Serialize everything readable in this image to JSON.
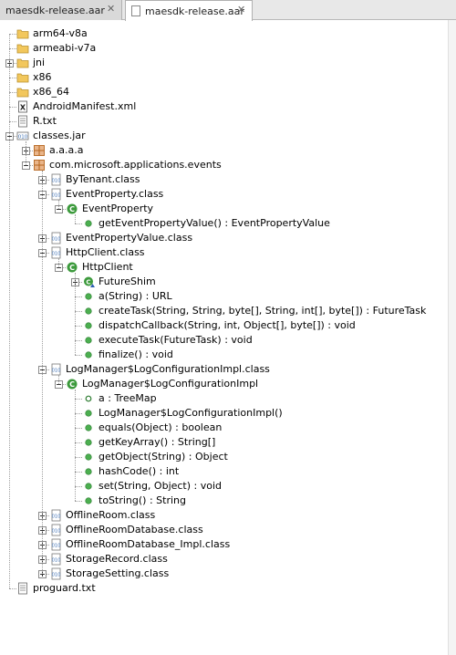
{
  "tabs": [
    {
      "label": "maesdk-release.aar",
      "active": false
    },
    {
      "label": "maesdk-release.aar",
      "active": true
    }
  ],
  "tree": [
    {
      "label": "arm64-v8a",
      "icon": "folder",
      "toggle": "none",
      "depth": 0
    },
    {
      "label": "armeabi-v7a",
      "icon": "folder",
      "toggle": "none",
      "depth": 0
    },
    {
      "label": "jni",
      "icon": "folder",
      "toggle": "plus",
      "depth": 0
    },
    {
      "label": "x86",
      "icon": "folder",
      "toggle": "none",
      "depth": 0
    },
    {
      "label": "x86_64",
      "icon": "folder",
      "toggle": "none",
      "depth": 0
    },
    {
      "label": "AndroidManifest.xml",
      "icon": "xml",
      "toggle": "none",
      "depth": 0
    },
    {
      "label": "R.txt",
      "icon": "text",
      "toggle": "none",
      "depth": 0
    },
    {
      "label": "classes.jar",
      "icon": "jar",
      "toggle": "minus",
      "depth": 0
    },
    {
      "label": "a.a.a.a",
      "icon": "package",
      "toggle": "plus",
      "depth": 1
    },
    {
      "label": "com.microsoft.applications.events",
      "icon": "package",
      "toggle": "minus",
      "depth": 1
    },
    {
      "label": "ByTenant.class",
      "icon": "classfile",
      "toggle": "plus",
      "depth": 2
    },
    {
      "label": "EventProperty.class",
      "icon": "classfile",
      "toggle": "minus",
      "depth": 2
    },
    {
      "label": "EventProperty",
      "icon": "class",
      "toggle": "minus",
      "depth": 3
    },
    {
      "label": "getEventPropertyValue() : EventPropertyValue",
      "icon": "method",
      "toggle": "none",
      "depth": 4
    },
    {
      "label": "EventPropertyValue.class",
      "icon": "classfile",
      "toggle": "plus",
      "depth": 2
    },
    {
      "label": "HttpClient.class",
      "icon": "classfile",
      "toggle": "minus",
      "depth": 2
    },
    {
      "label": "HttpClient",
      "icon": "class",
      "toggle": "minus",
      "depth": 3
    },
    {
      "label": "FutureShim",
      "icon": "innerclass",
      "toggle": "plus",
      "depth": 4
    },
    {
      "label": "a(String) : URL",
      "icon": "method",
      "toggle": "none",
      "depth": 4
    },
    {
      "label": "createTask(String, String, byte[], String, int[], byte[]) : FutureTask",
      "icon": "method",
      "toggle": "none",
      "depth": 4
    },
    {
      "label": "dispatchCallback(String, int, Object[], byte[]) : void",
      "icon": "method",
      "toggle": "none",
      "depth": 4
    },
    {
      "label": "executeTask(FutureTask) : void",
      "icon": "method",
      "toggle": "none",
      "depth": 4
    },
    {
      "label": "finalize() : void",
      "icon": "method",
      "toggle": "none",
      "depth": 4
    },
    {
      "label": "LogManager$LogConfigurationImpl.class",
      "icon": "classfile",
      "toggle": "minus",
      "depth": 2
    },
    {
      "label": "LogManager$LogConfigurationImpl",
      "icon": "class",
      "toggle": "minus",
      "depth": 3
    },
    {
      "label": "a : TreeMap",
      "icon": "field",
      "toggle": "none",
      "depth": 4
    },
    {
      "label": "LogManager$LogConfigurationImpl()",
      "icon": "method",
      "toggle": "none",
      "depth": 4
    },
    {
      "label": "equals(Object) : boolean",
      "icon": "method",
      "toggle": "none",
      "depth": 4
    },
    {
      "label": "getKeyArray() : String[]",
      "icon": "method",
      "toggle": "none",
      "depth": 4
    },
    {
      "label": "getObject(String) : Object",
      "icon": "method",
      "toggle": "none",
      "depth": 4
    },
    {
      "label": "hashCode() : int",
      "icon": "method",
      "toggle": "none",
      "depth": 4
    },
    {
      "label": "set(String, Object) : void",
      "icon": "method",
      "toggle": "none",
      "depth": 4
    },
    {
      "label": "toString() : String",
      "icon": "method",
      "toggle": "none",
      "depth": 4
    },
    {
      "label": "OfflineRoom.class",
      "icon": "classfile",
      "toggle": "plus",
      "depth": 2
    },
    {
      "label": "OfflineRoomDatabase.class",
      "icon": "classfile",
      "toggle": "plus",
      "depth": 2
    },
    {
      "label": "OfflineRoomDatabase_Impl.class",
      "icon": "classfile",
      "toggle": "plus",
      "depth": 2
    },
    {
      "label": "StorageRecord.class",
      "icon": "classfile",
      "toggle": "plus",
      "depth": 2
    },
    {
      "label": "StorageSetting.class",
      "icon": "classfile",
      "toggle": "plus",
      "depth": 2
    },
    {
      "label": "proguard.txt",
      "icon": "text",
      "toggle": "none",
      "depth": 0
    }
  ],
  "colors": {
    "folder": "#f2c75c",
    "class_green": "#3c9a3c",
    "method_green": "#4caf50",
    "package_brown": "#b5651d",
    "classfile_blue": "#3b6fb6"
  }
}
